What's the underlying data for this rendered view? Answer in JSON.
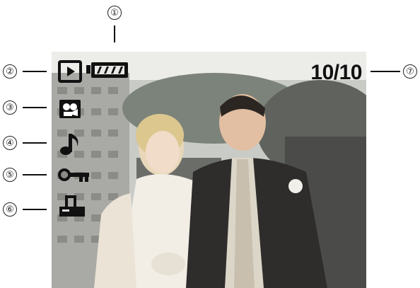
{
  "callouts": [
    "①",
    "②",
    "③",
    "④",
    "⑤",
    "⑥",
    "⑦"
  ],
  "osd": {
    "counter": "10/10",
    "icons": [
      "play-mode-icon",
      "battery-icon",
      "movie-clip-icon",
      "voice-memo-icon",
      "protect-key-icon",
      "dpof-print-icon"
    ]
  },
  "colors": {
    "icon": "#111111",
    "line": "#111111"
  }
}
